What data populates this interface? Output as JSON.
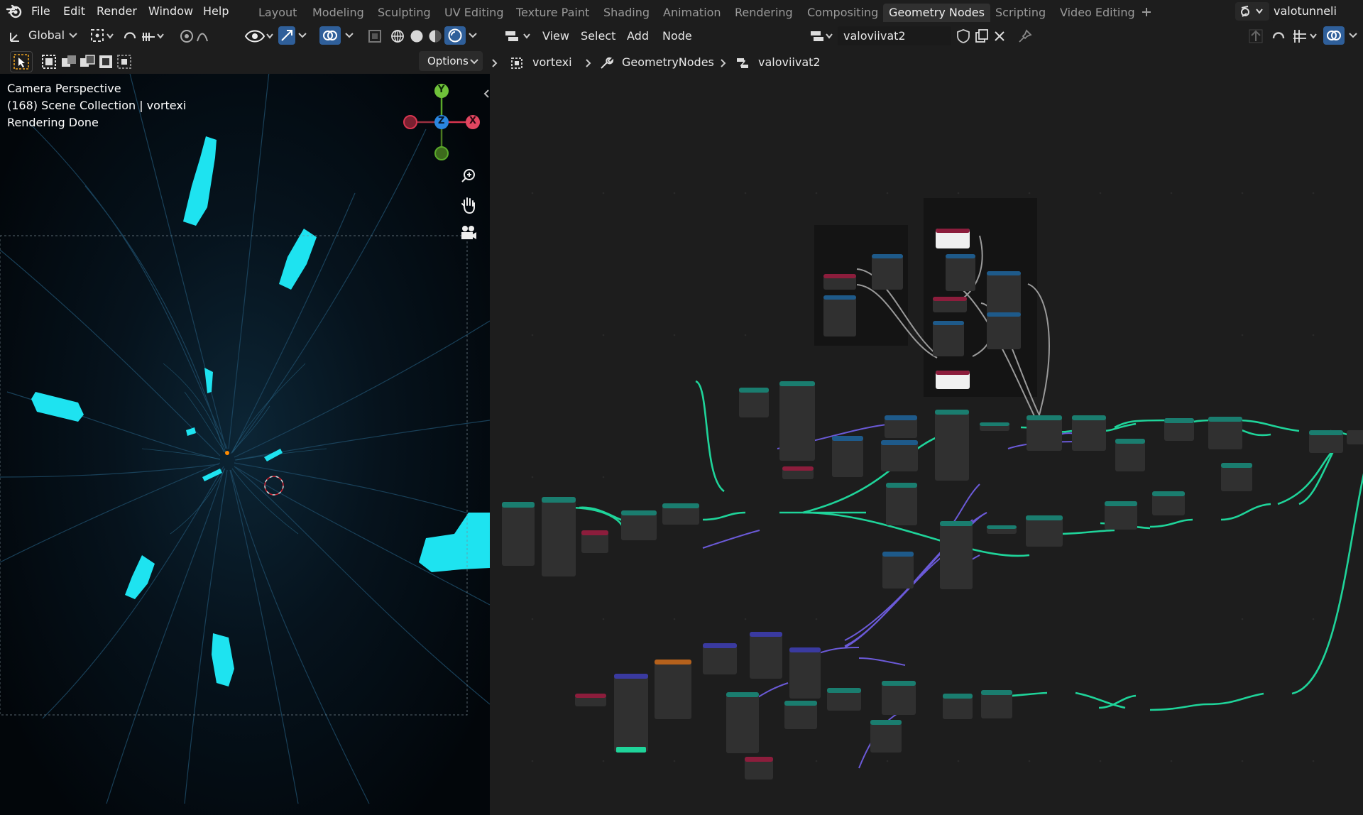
{
  "menu": {
    "file": "File",
    "edit": "Edit",
    "render": "Render",
    "window": "Window",
    "help": "Help"
  },
  "workspaces": [
    {
      "label": "Layout"
    },
    {
      "label": "Modeling"
    },
    {
      "label": "Sculpting"
    },
    {
      "label": "UV Editing"
    },
    {
      "label": "Texture Paint"
    },
    {
      "label": "Shading"
    },
    {
      "label": "Animation"
    },
    {
      "label": "Rendering"
    },
    {
      "label": "Compositing"
    },
    {
      "label": "Geometry Nodes"
    },
    {
      "label": "Scripting"
    },
    {
      "label": "Video Editing"
    }
  ],
  "add_workspace_icon": "plus-icon",
  "scene_name": "valotunneli",
  "viewport": {
    "orientation": "Global",
    "options_label": "Options",
    "overlay_lines": [
      "Camera Perspective",
      "(168) Scene Collection | vortexi",
      "Rendering Done"
    ],
    "gizmo": {
      "y": "Y",
      "z": "Z",
      "x": "X"
    },
    "accent": "#1ee3f0"
  },
  "node_editor": {
    "menus": {
      "view": "View",
      "select": "Select",
      "add": "Add",
      "node": "Node"
    },
    "node_group": "valoviivat2",
    "breadcrumb": [
      "vortexi",
      "GeometryNodes",
      "valoviivat2"
    ]
  },
  "colors": {
    "wire_green": "#1fd49a",
    "wire_purple": "#6b5ad8",
    "wire_gray": "#9a9a9a",
    "node_body": "#303030",
    "header_geometry": "#1a7d6f",
    "header_input": "#8c1d3c",
    "header_utility": "#1e5a8a",
    "header_texture": "#b5611c",
    "header_vector": "#3a3aa0"
  }
}
